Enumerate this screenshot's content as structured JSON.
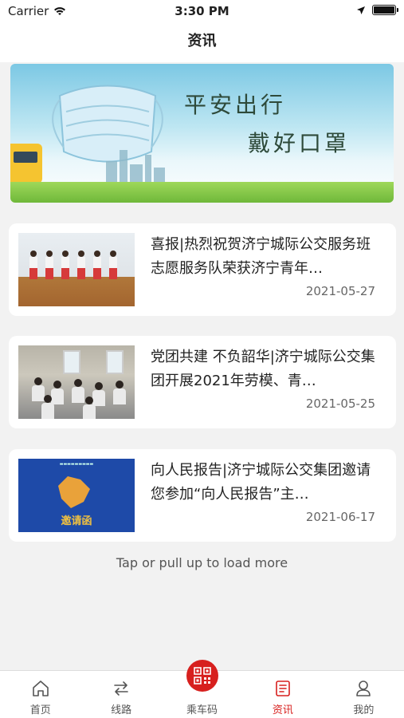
{
  "status_bar": {
    "carrier": "Carrier",
    "time": "3:30 PM"
  },
  "nav": {
    "title": "资讯"
  },
  "banner": {
    "line1": "平安出行",
    "line2": "戴好口罩"
  },
  "news": [
    {
      "title": "喜报|热烈祝贺济宁城际公交服务班志愿服务队荣获济宁青年…",
      "date": "2021-05-27"
    },
    {
      "title": "党团共建 不负韶华|济宁城际公交集团开展2021年劳模、青…",
      "date": "2021-05-25"
    },
    {
      "title": "向人民报告|济宁城际公交集团邀请您参加“向人民报告”主…",
      "date": "2021-06-17",
      "thumb_text": "邀请函"
    }
  ],
  "load_more": "Tap or pull up to load more",
  "tabs": [
    {
      "label": "首页",
      "icon": "home-icon"
    },
    {
      "label": "线路",
      "icon": "route-icon"
    },
    {
      "label": "乘车码",
      "icon": "qr-code-icon"
    },
    {
      "label": "资讯",
      "icon": "news-icon",
      "active": true
    },
    {
      "label": "我的",
      "icon": "profile-icon"
    }
  ],
  "colors": {
    "accent": "#d7201e",
    "background": "#f2f2f2"
  }
}
